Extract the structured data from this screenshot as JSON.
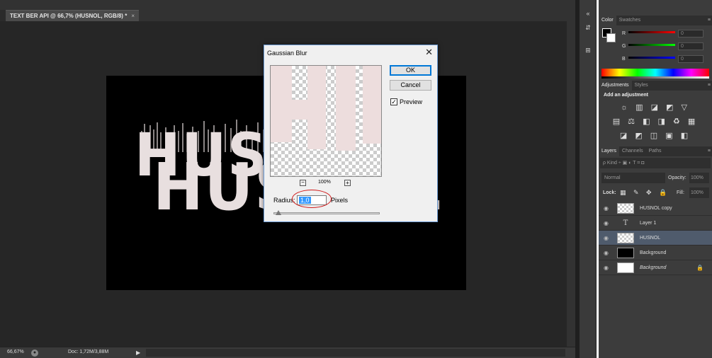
{
  "document": {
    "tab_title": "TEXT BER API @ 66,7% (HUSNOL, RGB/8) *",
    "tab_close": "×",
    "canvas_text_top": "HUS",
    "canvas_text_main": "HUSNOL"
  },
  "status_bar": {
    "zoom": "66,67%",
    "doc_size": "Doc: 1,72M/3,88M",
    "arrow": "▶"
  },
  "dialog": {
    "title": "Gaussian Blur",
    "close": "✕",
    "ok_label": "OK",
    "cancel_label": "Cancel",
    "preview_label": "Preview",
    "preview_checked": true,
    "preview_check_glyph": "✓",
    "zoom_out": "−",
    "zoom_in": "+",
    "zoom_percent": "100%",
    "radius_label": "Radius:",
    "radius_value": "1,0",
    "pixels_label": "Pixels"
  },
  "icon_strip": {
    "collapse": "«",
    "icon1": "⇵",
    "icon2": "⊞"
  },
  "color_panel": {
    "tabs": [
      "Color",
      "Swatches"
    ],
    "r_label": "R",
    "g_label": "G",
    "b_label": "B",
    "r_value": "0",
    "g_value": "0",
    "b_value": "0",
    "menu": "≡"
  },
  "adjustments_panel": {
    "tabs": [
      "Adjustments",
      "Styles"
    ],
    "title": "Add an adjustment",
    "row1": "☼ ▥ ◪ ◩ ▽",
    "row2": "▤ ⚖ ◧ ◨ ♻ ▦",
    "row3": "◪ ◩ ◫ ▣ ◧",
    "menu": "≡"
  },
  "layers_panel": {
    "tabs": [
      "Layers",
      "Channels",
      "Paths"
    ],
    "kind": "ρ Kind   ÷   ▣  ◐  T  ⌗  ◘",
    "blend_mode": "Normal",
    "opacity_label": "Opacity:",
    "opacity_value": "100%",
    "lock_label": "Lock:",
    "lock_icons": "▦ ✎ ✥ 🔒",
    "fill_label": "Fill:",
    "fill_value": "100%",
    "menu": "≡",
    "layers": [
      {
        "name": "HUSNOL copy",
        "thumb": "checker",
        "selected": false,
        "italic": false
      },
      {
        "name": "Layer 1",
        "thumb": "type",
        "selected": false,
        "italic": false
      },
      {
        "name": "HUSNOL",
        "thumb": "checker",
        "selected": true,
        "italic": false
      },
      {
        "name": "Background",
        "thumb": "black",
        "selected": false,
        "italic": false
      },
      {
        "name": "Background",
        "thumb": "white",
        "selected": false,
        "italic": true,
        "locked": true
      }
    ],
    "eye_glyph": "◉",
    "type_glyph": "T",
    "lock_glyph": "🔒"
  }
}
